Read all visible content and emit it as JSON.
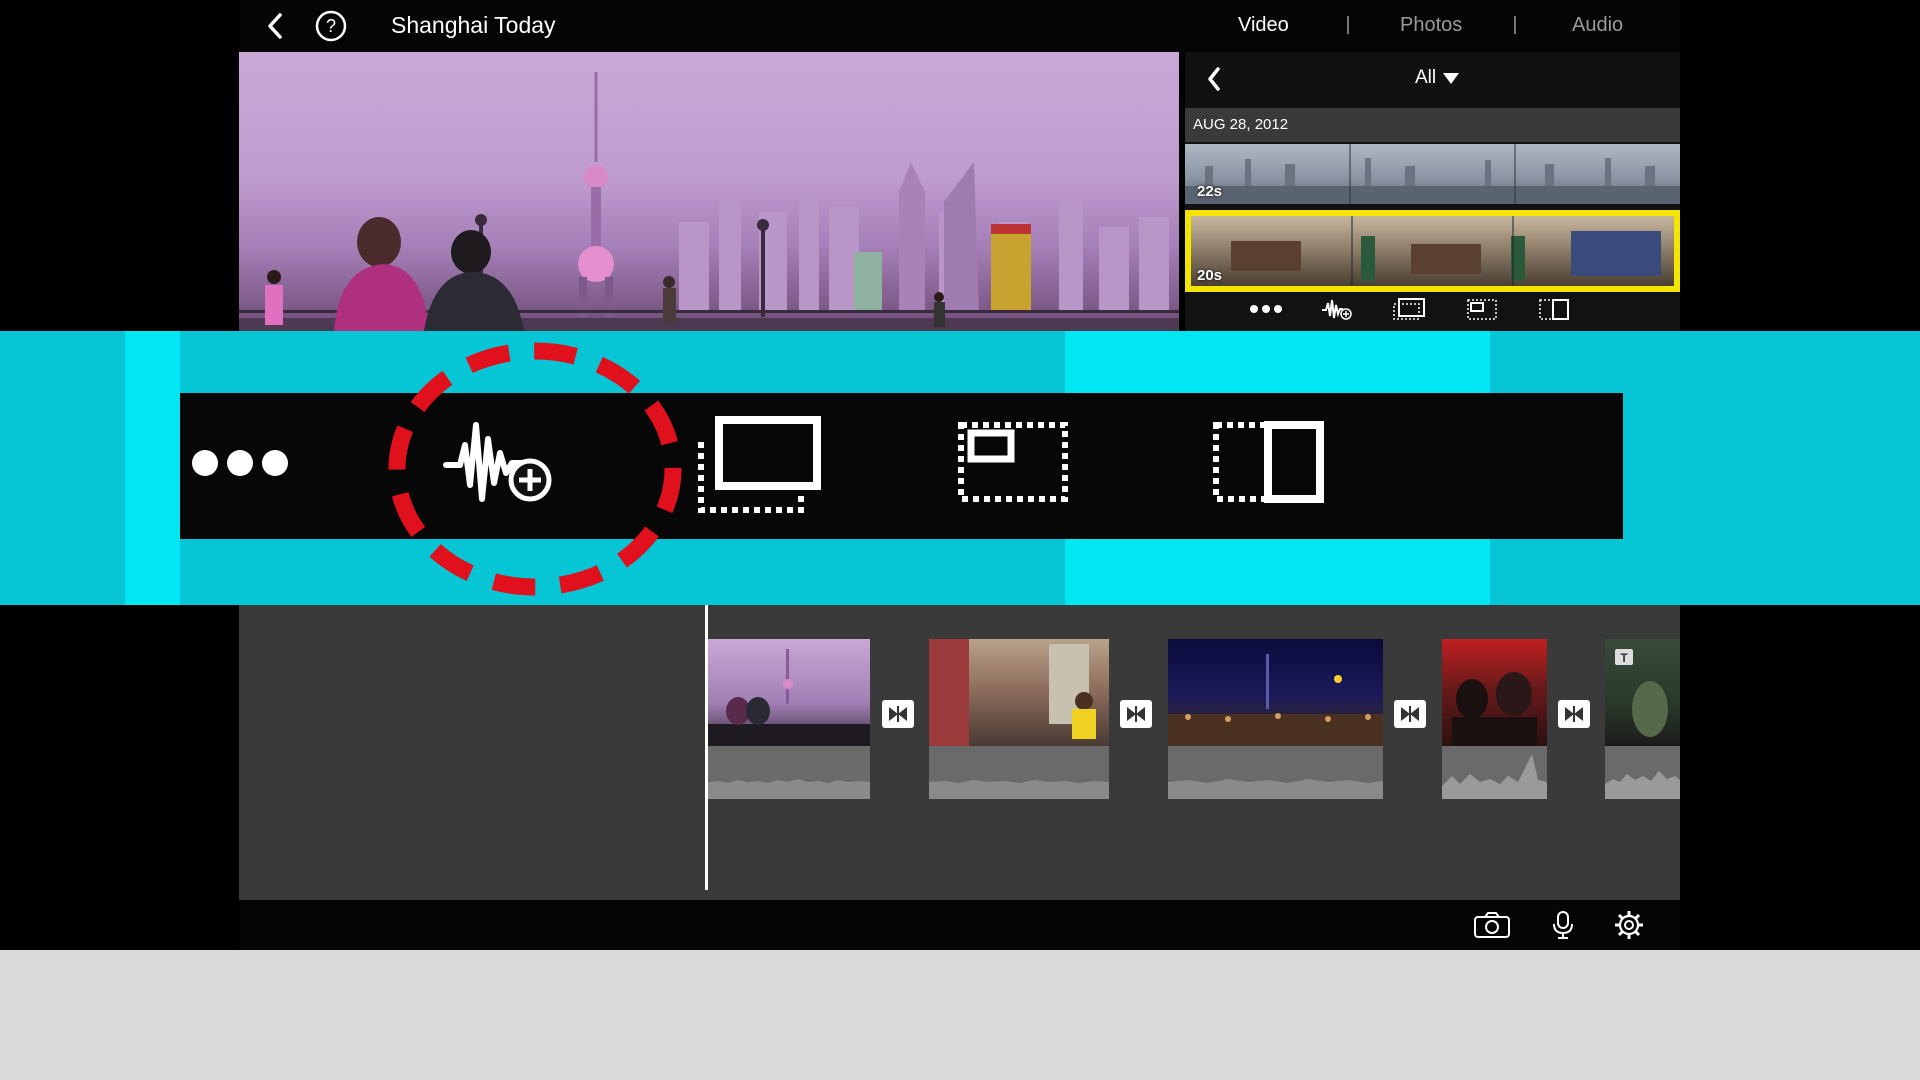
{
  "header": {
    "title": "Shanghai Today",
    "tabs": [
      {
        "label": "Video",
        "active": true
      },
      {
        "label": "Photos",
        "active": false
      },
      {
        "label": "Audio",
        "active": false
      }
    ],
    "icons": {
      "back": "chevron-left-icon",
      "help": "question-circle-icon"
    }
  },
  "browser": {
    "filter_label": "All",
    "date": "AUG 28, 2012",
    "clips": [
      {
        "duration": "22s",
        "selected": false
      },
      {
        "duration": "20s",
        "selected": true
      }
    ],
    "selected_color": "#f5e400"
  },
  "toolbar": {
    "tools": [
      {
        "name": "more-icon"
      },
      {
        "name": "audio-add-icon",
        "highlighted": true
      },
      {
        "name": "cutaway-icon"
      },
      {
        "name": "picture-in-picture-icon"
      },
      {
        "name": "split-screen-icon"
      }
    ],
    "highlight_color": "#e0101c",
    "band_color": "#06c6d6"
  },
  "timeline": {
    "clips": [
      "clip-1",
      "clip-2",
      "clip-3",
      "clip-4",
      "clip-5"
    ],
    "transition_icon": "bowtie-transition-icon"
  },
  "bottom_bar": {
    "icons": [
      "camera-icon",
      "microphone-icon",
      "settings-gear-icon"
    ]
  }
}
